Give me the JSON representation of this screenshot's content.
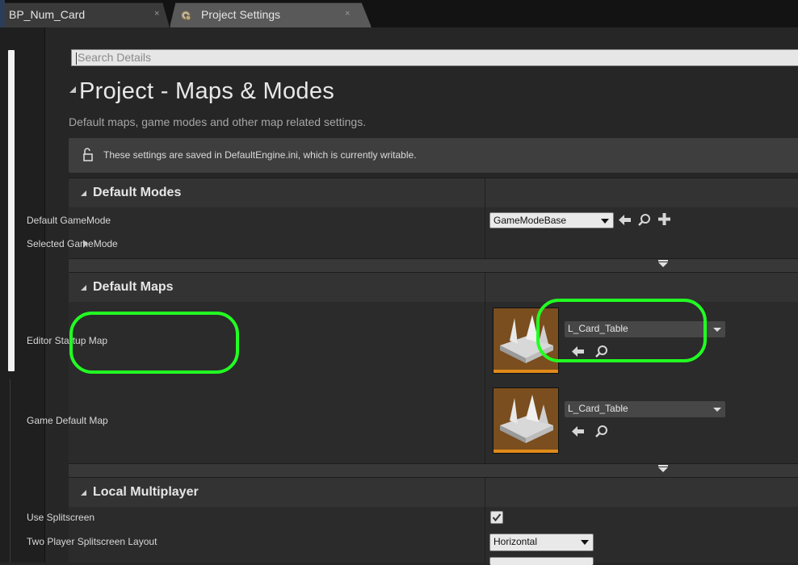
{
  "tabs": [
    {
      "label": "BP_Num_Card",
      "close": "×"
    },
    {
      "label": "Project Settings",
      "close": "×"
    }
  ],
  "search": {
    "placeholder": "Search Details"
  },
  "page": {
    "title": "Project - Maps & Modes",
    "description": "Default maps, game modes and other map related settings."
  },
  "notice": {
    "text": "These settings are saved in DefaultEngine.ini, which is currently writable."
  },
  "sections": {
    "default_modes": {
      "title": "Default Modes",
      "rows": {
        "default_gamemode": {
          "label": "Default GameMode",
          "value": "GameModeBase"
        },
        "selected_gamemode": {
          "label": "Selected GameMode"
        }
      }
    },
    "default_maps": {
      "title": "Default Maps",
      "rows": {
        "editor_startup_map": {
          "label": "Editor Startup Map",
          "value": "L_Card_Table"
        },
        "game_default_map": {
          "label": "Game Default Map",
          "value": "L_Card_Table"
        }
      }
    },
    "local_multiplayer": {
      "title": "Local Multiplayer",
      "rows": {
        "use_splitscreen": {
          "label": "Use Splitscreen",
          "checked": true
        },
        "two_player_layout": {
          "label": "Two Player Splitscreen Layout",
          "value": "Horizontal"
        }
      }
    }
  },
  "colors": {
    "highlight": "#22ff22",
    "thumbnail": "#7a4e1e",
    "thumbnail_bar": "#e08a1a"
  }
}
